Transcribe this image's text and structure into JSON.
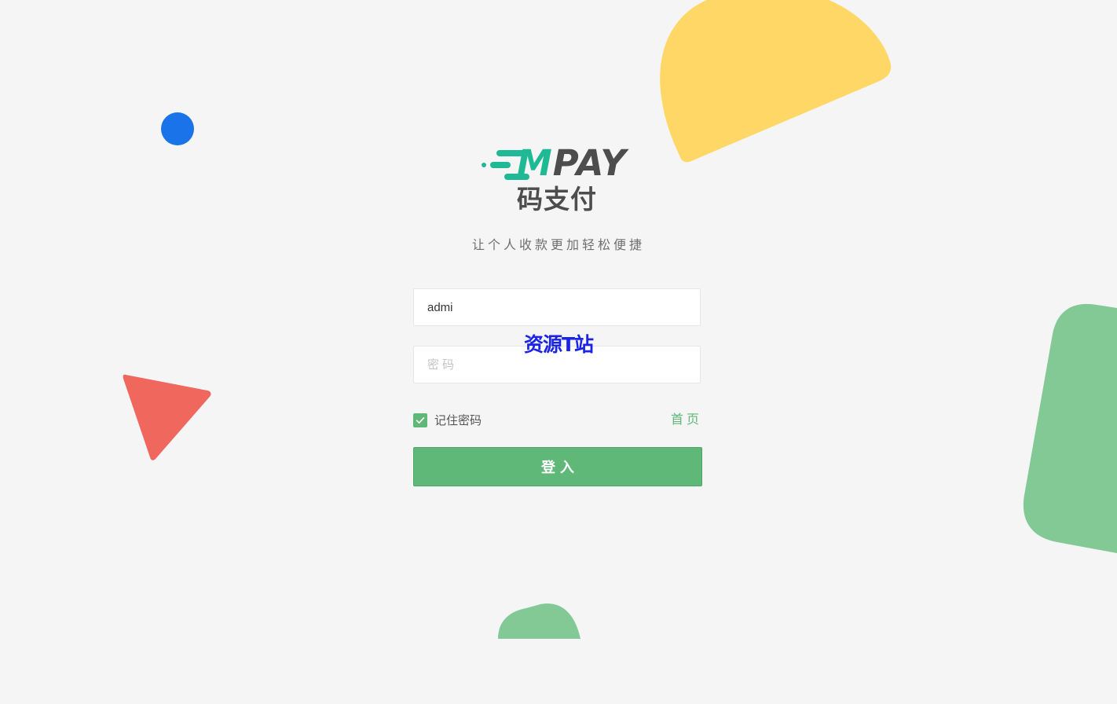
{
  "brand": {
    "logo_text_prefix": "M",
    "logo_text_rest": "PAY",
    "logo_subtitle": "码支付",
    "tagline": "让个人收款更加轻松便捷",
    "accent_color": "#1fb996",
    "logo_text_color": "#4d4d4d"
  },
  "login_form": {
    "username_value": "admi",
    "username_placeholder": "",
    "password_placeholder": "密码",
    "remember_label": "记住密码",
    "remember_checked": true,
    "home_link": "首页",
    "submit_label": "登入"
  },
  "watermark": "资源T站",
  "colors": {
    "background": "#f5f5f5",
    "primary_green": "#5fb878",
    "deco_yellow": "#ffd766",
    "deco_blue": "#1a73e8",
    "deco_red": "#ef675d",
    "deco_green": "#82c995"
  },
  "icons": {
    "checkbox": "check-icon"
  }
}
